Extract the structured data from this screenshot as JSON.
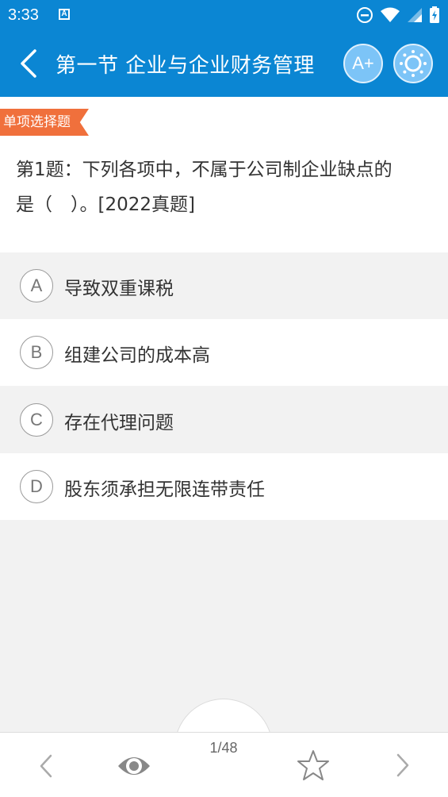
{
  "status_bar": {
    "time": "3:33",
    "notification_icon": "A",
    "icons": [
      "do-not-disturb-icon",
      "wifi-icon",
      "signal-icon",
      "battery-icon"
    ]
  },
  "header": {
    "title": "第一节 企业与企业财务管理",
    "font_button_label": "A+",
    "background_color": "#0b86d3"
  },
  "question": {
    "type_tag": "单项选择题",
    "line1": "第1题：下列各项中，不属于公司制企业缺点的",
    "line2": "是（　）。[2022真题]",
    "tag_color": "#f0703c"
  },
  "options": [
    {
      "letter": "A",
      "text": "导致双重课税"
    },
    {
      "letter": "B",
      "text": "组建公司的成本高"
    },
    {
      "letter": "C",
      "text": "存在代理问题"
    },
    {
      "letter": "D",
      "text": "股东须承担无限连带责任"
    }
  ],
  "footer": {
    "page_indicator": "1/48",
    "icons": [
      "prev-icon",
      "eye-icon",
      "star-icon",
      "next-icon"
    ]
  }
}
